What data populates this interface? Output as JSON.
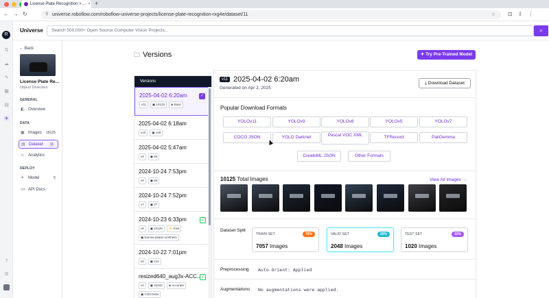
{
  "browser": {
    "tab_title": "License Plate Recognition > ...",
    "tab_close": "×",
    "new_tab": "+",
    "url": "universe.roboflow.com/roboflow-universe-projects/license-plate-recognition-rxg4e/dataset/11",
    "nav_icons": [
      "back-arrow-icon",
      "forward-arrow-icon",
      "reload-icon"
    ],
    "nav_glyphs": [
      "←",
      "→",
      "↻"
    ],
    "right_glyphs": [
      "⊡",
      "⇩",
      "⋮"
    ],
    "star": "☆"
  },
  "header": {
    "brand": "Universe",
    "search_placeholder": "Search 500,000+ Open Source Computer Vision Projects...",
    "search_icon": "⌕"
  },
  "rail": {
    "logo": "R",
    "icons": [
      "transform-icon",
      "upload-icon",
      "annotate-icon",
      "dataset-icon",
      "models-icon",
      "deploy-icon",
      "universe-icon",
      "help-icon",
      "settings-icon"
    ],
    "glyphs": [
      "⇅",
      "☁",
      "✎",
      "▦",
      "▤",
      "⋯",
      "✈",
      "?",
      "⚙"
    ]
  },
  "sidebar": {
    "back": "← Back",
    "project_name": "License Plate Re...",
    "project_type": "Object Detection",
    "general": "GENERAL",
    "overview": "Overview",
    "data": "DATA",
    "images": "Images",
    "images_count": "18125",
    "dataset": "Dataset",
    "dataset_count": "11",
    "analytics": "Analytics",
    "deploy": "DEPLOY",
    "model": "Model",
    "model_count": "5",
    "api_docs": "API Docs",
    "glyphs": {
      "overview": "◧",
      "images": "▣",
      "dataset": "▤",
      "analytics": "∿",
      "model": "✈",
      "api_docs": "</>"
    }
  },
  "page": {
    "title": "Versions",
    "folder_glyph": "🗀",
    "try_button": "✦ Try Pre-Trained Model"
  },
  "versions": {
    "header": "Versions",
    "items": [
      {
        "date": "2025-04-02 6:20am",
        "tags": [
          "v11",
          "▣ 10125",
          "◈ Base"
        ],
        "check": "✓"
      },
      {
        "date": "2025-04-02 6:18am",
        "tags": [
          "v10",
          "▣ 149"
        ]
      },
      {
        "date": "2025-04-02 5:47am",
        "tags": [
          "v9",
          "▣ 50"
        ]
      },
      {
        "date": "2024-10-24 7:53pm",
        "tags": [
          "v8",
          "▣ 50"
        ]
      },
      {
        "date": "2024-10-24 7:52pm",
        "tags": [
          "v7",
          "▣ 27"
        ]
      },
      {
        "date": "2024-10-23 6:33pm",
        "tags": [
          "v6",
          "▣ 10125",
          "⚡ Fast",
          "▣ license-plates-omhhw/1"
        ],
        "check": "✓"
      },
      {
        "date": "2024-10-22 7:01pm",
        "tags": [
          "v5",
          "▣ 122"
        ]
      },
      {
        "date": "resized640_aug3x-ACC...",
        "tags": [
          "v4",
          "▣ 24242",
          "◈ Accurate",
          "▣ COCOv8s"
        ],
        "check": "✓"
      }
    ]
  },
  "detail": {
    "version_badge": "v11",
    "title": "2025-04-02 6:20am",
    "generated": "Generated on Apr 2, 2025",
    "download_button": "⤓ Download Dataset",
    "popular_formats": "Popular Download Formats",
    "formats_row1": [
      "YOLOv11",
      "YOLOv9",
      "YOLOv8",
      "YOLOv5",
      "YOLOv7"
    ],
    "formats_row2": [
      "COCO JSON",
      "YOLO Darknet",
      "Pascal VOC XML",
      "TFRecord",
      "PaliGemma"
    ],
    "formats_row3": [
      "CreateML JSON",
      "Other Formats"
    ],
    "total_count": "10125",
    "total_label": "Total Images",
    "view_all": "View All Images →",
    "dataset_split": "Dataset Split",
    "splits": [
      {
        "label": "TRAIN SET",
        "percent": "70%",
        "count": "7057",
        "unit": "Images",
        "color": "#f97316",
        "border": "#d1d5db"
      },
      {
        "label": "VALID SET",
        "percent": "20%",
        "count": "2048",
        "unit": "Images",
        "color": "#22b8cf",
        "border": "#67e8f9"
      },
      {
        "label": "TEST SET",
        "percent": "10%",
        "count": "1020",
        "unit": "Images",
        "color": "#a855f7",
        "border": "#d1d5db"
      }
    ],
    "preprocessing_label": "Preprocessing",
    "preprocessing_value": "Auto-Orient: Applied",
    "augmentations_label": "Augmentations",
    "augmentations_value": "No augmentations were applied."
  }
}
